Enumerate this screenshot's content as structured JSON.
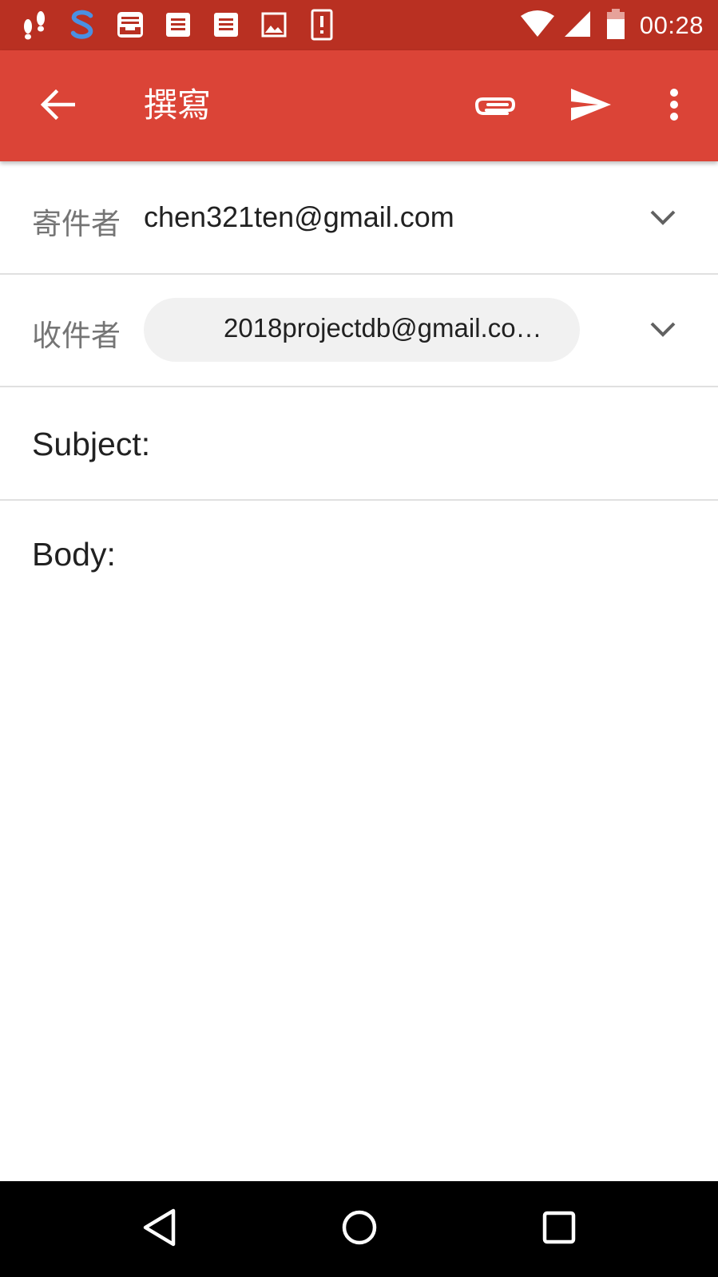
{
  "status_bar": {
    "time": "00:28",
    "left_icons": [
      "footprints-icon",
      "s-app-icon",
      "inbox-tray-icon",
      "document-icon",
      "document-icon",
      "image-icon",
      "alert-icon"
    ],
    "right_icons": [
      "wifi-icon",
      "cell-signal-icon",
      "battery-icon"
    ]
  },
  "app_bar": {
    "title": "撰寫",
    "icons": [
      "back-arrow-icon",
      "attach-icon",
      "send-icon",
      "more-vert-icon"
    ],
    "color": "#db4437"
  },
  "compose": {
    "from_label": "寄件者",
    "from_value": "chen321ten@gmail.com",
    "to_label": "收件者",
    "to_chip": "2018projectdb@gmail.co…",
    "subject_label": "Subject:",
    "subject_value": "",
    "body_label": "Body:"
  },
  "nav_bar": {
    "icons": [
      "nav-back-icon",
      "nav-home-icon",
      "nav-recents-icon"
    ]
  }
}
